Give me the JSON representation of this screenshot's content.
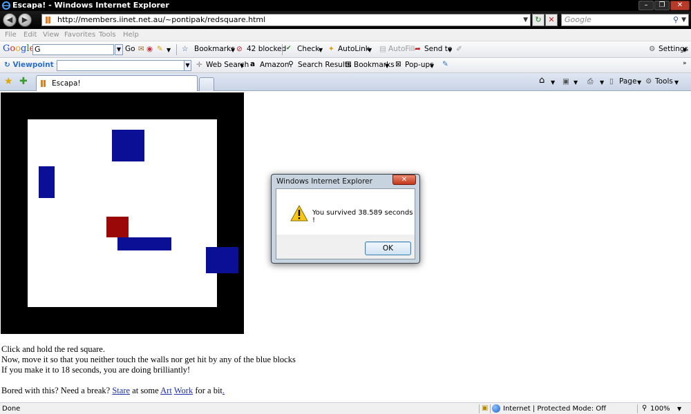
{
  "window": {
    "title": "Escapa! - Windows Internet Explorer"
  },
  "address_bar": {
    "url": "http://members.iinet.net.au/~pontipak/redsquare.html"
  },
  "search": {
    "placeholder": "Google"
  },
  "menu": {
    "items": [
      "File",
      "Edit",
      "View",
      "Favorites",
      "Tools",
      "Help"
    ]
  },
  "google_toolbar": {
    "logo_letters": [
      "G",
      "o",
      "o",
      "g",
      "l",
      "e"
    ],
    "search_value": "G",
    "go_label": "Go",
    "bookmarks_label": "Bookmarks",
    "blocked_label": "42 blocked",
    "check_label": "Check",
    "autolink_label": "AutoLink",
    "autofill_label": "AutoFill",
    "sendto_label": "Send to",
    "settings_label": "Settings"
  },
  "viewpoint_toolbar": {
    "brand": "Viewpoint",
    "web_search_label": "Web Search",
    "amazon_label": "Amazon",
    "search_results_label": "Search Results",
    "bookmarks_label": "Bookmarks",
    "popups_label": "Pop-ups"
  },
  "tabs": {
    "active_label": "Escapa!"
  },
  "command_bar": {
    "page_label": "Page",
    "tools_label": "Tools"
  },
  "content": {
    "instructions": [
      "Click and hold the red square.",
      "Now, move it so that you neither touch the walls nor get hit by any of the blue blocks",
      "If you make it to 18 seconds, you are doing brilliantly!"
    ],
    "footer": {
      "prefix": "Bored with this? Need a break?",
      "link_stare": "Stare",
      "middle": "at some",
      "link_art": "Art",
      "link_work": "Work",
      "suffix": "for a bit"
    },
    "colors": {
      "arena_border": "#000000",
      "blue_block": "#0a0f96",
      "red_square": "#9a0808"
    }
  },
  "dialog": {
    "title": "Windows Internet Explorer",
    "message": "You survived 38.589 seconds !",
    "ok_label": "OK"
  },
  "status_bar": {
    "status": "Done",
    "zone": "Internet | Protected Mode: Off",
    "zoom": "100%"
  }
}
